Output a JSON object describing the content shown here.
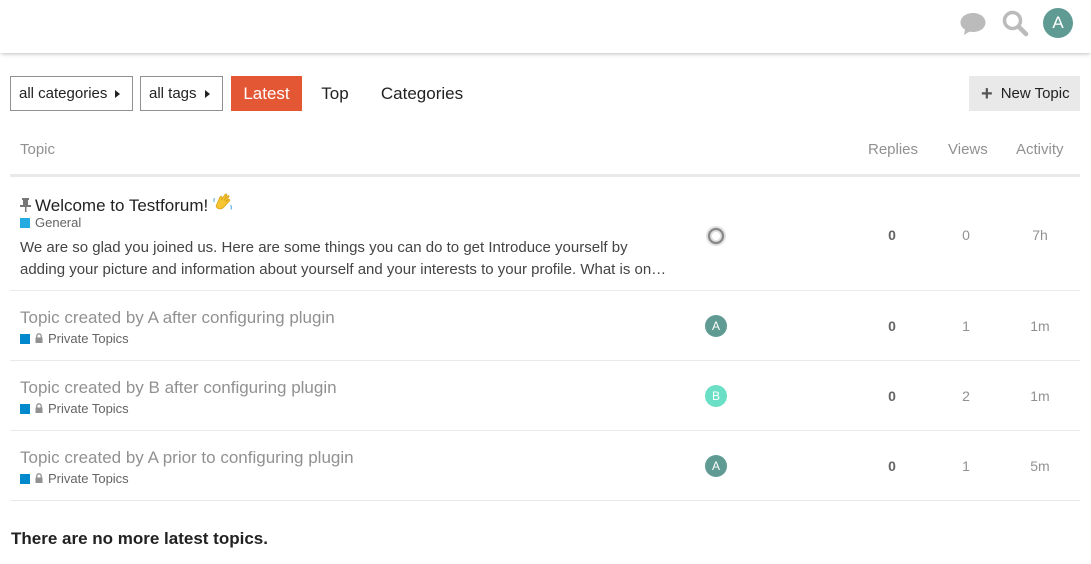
{
  "header": {
    "avatar_letter": "A",
    "avatar_color": "#5f9b93",
    "icons": [
      "chat-icon",
      "search-icon"
    ]
  },
  "nav": {
    "categories_dropdown": "all categories",
    "tags_dropdown": "all tags",
    "tabs": [
      {
        "label": "Latest",
        "active": true
      },
      {
        "label": "Top",
        "active": false
      },
      {
        "label": "Categories",
        "active": false
      }
    ],
    "new_topic_label": "New Topic",
    "accent_color": "#e45735"
  },
  "table": {
    "headers": {
      "topic": "Topic",
      "replies": "Replies",
      "views": "Views",
      "activity": "Activity"
    },
    "rows": [
      {
        "title": "Welcome to Testforum!",
        "pinned": true,
        "category": "General",
        "category_color": "#25aae1",
        "excerpt": "We are so glad you joined us. Here are some things you can do to get Introduce yourself by adding your picture and information about yourself and your interests to your profile. What is on…",
        "poster": "",
        "replies": "0",
        "views": "0",
        "activity": "7h"
      },
      {
        "title": "Topic created by A after configuring plugin",
        "category": "Private Topics",
        "category_color": "#0088cc",
        "poster": "A",
        "poster_color": "#5f9b93",
        "replies": "0",
        "views": "1",
        "activity": "1m"
      },
      {
        "title": "Topic created by B after configuring plugin",
        "category": "Private Topics",
        "category_color": "#0088cc",
        "poster": "B",
        "poster_color": "#6adfc5",
        "replies": "0",
        "views": "2",
        "activity": "1m"
      },
      {
        "title": "Topic created by A prior to configuring plugin",
        "category": "Private Topics",
        "category_color": "#0088cc",
        "poster": "A",
        "poster_color": "#5f9b93",
        "replies": "0",
        "views": "1",
        "activity": "5m"
      }
    ]
  },
  "footer": {
    "message": "There are no more latest topics."
  }
}
